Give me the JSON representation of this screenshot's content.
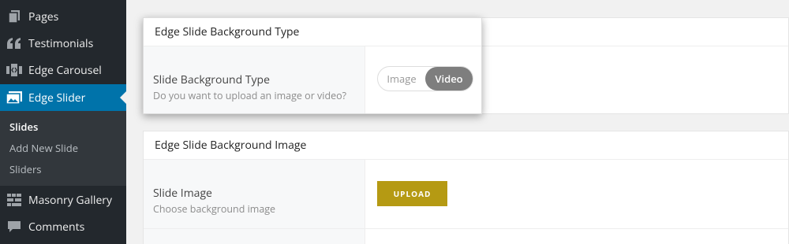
{
  "sidebar": {
    "items": [
      {
        "label": "Pages",
        "icon": "pages-icon"
      },
      {
        "label": "Testimonials",
        "icon": "quote-icon"
      },
      {
        "label": "Edge Carousel",
        "icon": "carousel-icon"
      },
      {
        "label": "Edge Slider",
        "icon": "slider-icon",
        "active": true
      },
      {
        "label": "Masonry Gallery",
        "icon": "grid-icon"
      },
      {
        "label": "Comments",
        "icon": "comment-icon"
      }
    ],
    "submenu": [
      {
        "label": "Slides",
        "current": true
      },
      {
        "label": "Add New Slide"
      },
      {
        "label": "Sliders"
      }
    ]
  },
  "panel_type": {
    "title": "Edge Slide Background Type",
    "field_title": "Slide Background Type",
    "field_desc": "Do you want to upload an image or video?",
    "options": [
      "Image",
      "Video"
    ],
    "selected": "Video"
  },
  "panel_image": {
    "title": "Edge Slide Background Image",
    "field_title": "Slide Image",
    "field_desc": "Choose background image",
    "upload_label": "UPLOAD"
  },
  "colors": {
    "sidebar_bg": "#23282d",
    "active_bg": "#0073aa",
    "upload_bg": "#b59a13",
    "toggle_on": "#7e7e7e"
  }
}
